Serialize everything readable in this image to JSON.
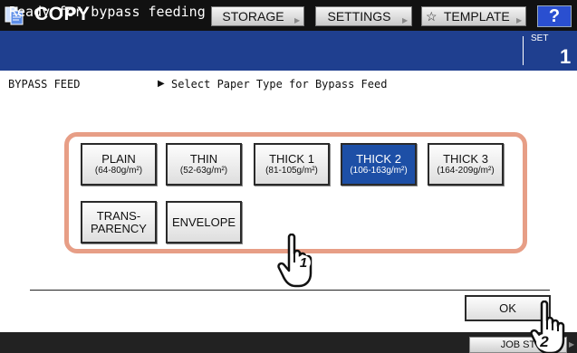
{
  "header": {
    "app_title": "COPY",
    "tabs": [
      {
        "label": "STORAGE"
      },
      {
        "label": "SETTINGS"
      },
      {
        "label": "TEMPLATE"
      }
    ],
    "help_label": "?"
  },
  "status": {
    "message": "Ready for bypass feeding",
    "set_label": "SET",
    "set_count": "1"
  },
  "breadcrumb": {
    "section": "BYPASS FEED",
    "instruction": "Select Paper Type for Bypass Feed"
  },
  "paper_types": [
    {
      "label": "PLAIN",
      "sub": "(64-80g/m²)"
    },
    {
      "label": "THIN",
      "sub": "(52-63g/m²)"
    },
    {
      "label": "THICK 1",
      "sub": "(81-105g/m²)"
    },
    {
      "label": "THICK 2",
      "sub": "(106-163g/m²)",
      "selected": true
    },
    {
      "label": "THICK 3",
      "sub": "(164-209g/m²)"
    },
    {
      "label_line1": "TRANS-",
      "label_line2": "PARENCY"
    },
    {
      "label": "ENVELOPE"
    }
  ],
  "actions": {
    "ok_label": "OK"
  },
  "footer": {
    "job_status_label": "JOB ST"
  },
  "callouts": {
    "step1": "1",
    "step2": "2"
  },
  "colors": {
    "status_bar": "#1f3f8f",
    "selected_button": "#1d4fa6",
    "highlight_frame": "#e79e86"
  }
}
